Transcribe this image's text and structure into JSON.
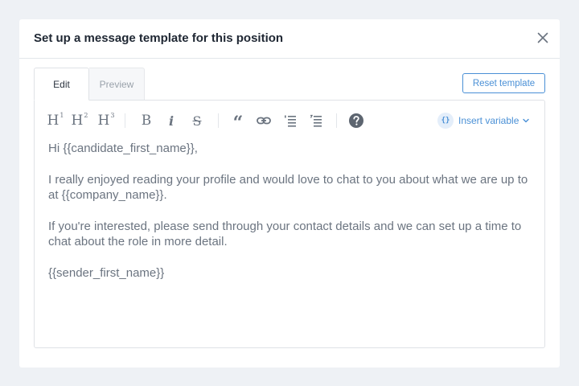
{
  "modal": {
    "title": "Set up a message template for this position"
  },
  "tabs": [
    {
      "label": "Edit"
    },
    {
      "label": "Preview"
    }
  ],
  "reset_label": "Reset template",
  "toolbar": {
    "h1_letter": "H",
    "h1_sup": "1",
    "h2_letter": "H",
    "h2_sup": "2",
    "h3_letter": "H",
    "h3_sup": "3",
    "bold": "B",
    "italic": "i",
    "strike": "S",
    "quote": "“",
    "insert_badge": "{}",
    "insert_label": "Insert variable"
  },
  "content": {
    "paragraphs": [
      "Hi {{candidate_first_name}},",
      "I really enjoyed reading your profile and would love to chat to you about what we are up to at {{company_name}}.",
      "If you're interested, please send through your contact details and we can set up a time to chat about the role in more detail.",
      "{{sender_first_name}}"
    ]
  },
  "colors": {
    "accent": "#4a90d6",
    "text": "#6b7480",
    "title": "#1f2733"
  }
}
